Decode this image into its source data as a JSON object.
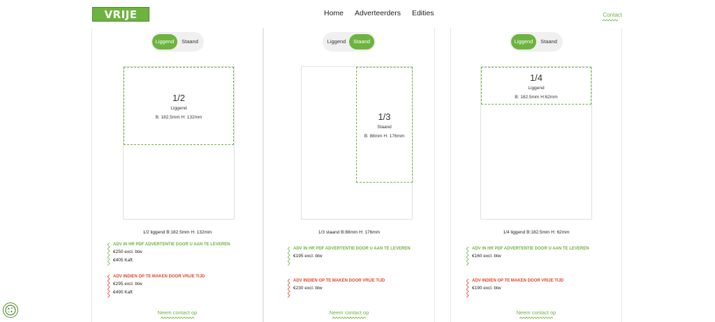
{
  "header": {
    "logo": "VRIJE TIJD",
    "nav": [
      "Home",
      "Adverteerders",
      "Edities"
    ],
    "contact": "Contact"
  },
  "columns": [
    {
      "toggle": [
        "Liggend",
        "Staand"
      ],
      "active": "Liggend",
      "ad": {
        "fraction": "1/2",
        "orientation": "Liggend",
        "size": "B: 182.5mm H: 132mm"
      },
      "spec": "1/2 liggend B:182.5mm H: 132mm",
      "pdf_title": "ADV IN HR PDF ADVERTENTIE DOOR U AAN TE LEVEREN",
      "pdf_prices": [
        "€250 excl. btw",
        "€405 Kaft"
      ],
      "make_title": "ADV INDIEN OP TE MAKEN DOOR VRIJE TIJD",
      "make_prices": [
        "€295 excl. btw",
        "€490 Kaft"
      ],
      "cta": "Neem contact op"
    },
    {
      "toggle": [
        "Liggend",
        "Staand"
      ],
      "active": "Staand",
      "ad": {
        "fraction": "1/3",
        "orientation": "Staand",
        "size": "B: 88mm H: 176mm"
      },
      "spec": "1/3 staand B:88mm H: 176mm",
      "pdf_title": "ADV IN HR PDF ADVERTENTIE DOOR U AAN TE LEVEREN",
      "pdf_prices": [
        "€195 excl. btw"
      ],
      "make_title": "ADV INDIEN OP TE MAKEN DOOR VRIJE TIJD",
      "make_prices": [
        "€230 excl. btw"
      ],
      "cta": "Neem contact op"
    },
    {
      "toggle": [
        "Liggend",
        "Staand"
      ],
      "active": "Liggend",
      "ad": {
        "fraction": "1/4",
        "orientation": "Liggend",
        "size": "B: 182.5mm H:62mm"
      },
      "spec": "1/4 liggend B:182.5mm H: 62mm",
      "pdf_title": "ADV IN HR PDF ADVERTENTIE DOOR U AAN TE LEVEREN",
      "pdf_prices": [
        "€160 excl. btw"
      ],
      "make_title": "ADV INDIEN OP TE MAKEN DOOR VRIJE TIJD",
      "make_prices": [
        "€190 excl. btw"
      ],
      "cta": "Neem contact op"
    }
  ],
  "colors": {
    "green": "#6db33f",
    "red": "#e0452b"
  },
  "icons": {
    "cookie": "cookie-icon"
  }
}
